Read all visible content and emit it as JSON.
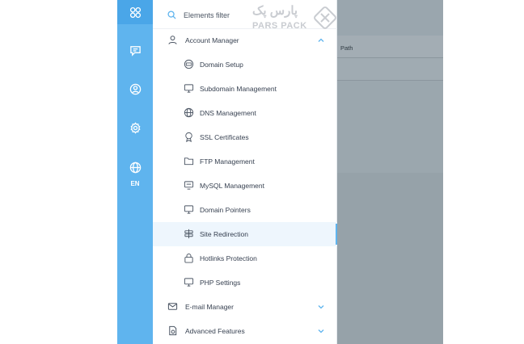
{
  "rail": {
    "lang": "EN",
    "icons": [
      "grid-icon",
      "chat-icon",
      "user-icon",
      "settings-icon",
      "globe-icon"
    ]
  },
  "filter": {
    "label": "Elements filter"
  },
  "menu": {
    "account_manager": "Account Manager",
    "items": [
      {
        "label": "Domain Setup",
        "icon": "domain-setup-icon"
      },
      {
        "label": "Subdomain Management",
        "icon": "subdomain-icon"
      },
      {
        "label": "DNS Management",
        "icon": "dns-icon"
      },
      {
        "label": "SSL Certificates",
        "icon": "ssl-icon"
      },
      {
        "label": "FTP Management",
        "icon": "ftp-folder-icon"
      },
      {
        "label": "MySQL Management",
        "icon": "mysql-icon"
      },
      {
        "label": "Domain Pointers",
        "icon": "domain-pointer-icon"
      },
      {
        "label": "Site Redirection",
        "icon": "redirect-icon"
      },
      {
        "label": "Hotlinks Protection",
        "icon": "lock-icon"
      },
      {
        "label": "PHP Settings",
        "icon": "php-icon"
      }
    ],
    "email_manager": "E-mail Manager",
    "advanced_features": "Advanced Features"
  },
  "content": {
    "column_header": "Path"
  },
  "logo": {
    "farsi": "پارس پک",
    "english": "PARS PACK"
  },
  "colors": {
    "rail": "#5fb4ee",
    "accent": "#5fb4ee",
    "text": "#374151"
  }
}
